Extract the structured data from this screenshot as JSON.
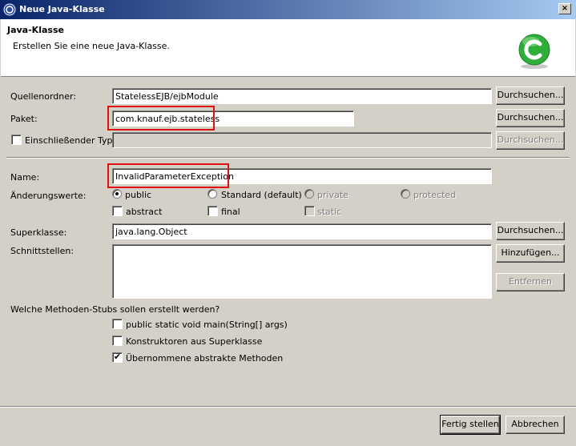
{
  "window": {
    "title": "Neue Java-Klasse",
    "close_label": "×"
  },
  "header": {
    "title": "Java-Klasse",
    "description": "Erstellen Sie eine neue Java-Klasse."
  },
  "source_folder": {
    "label": "Quellenordner:",
    "value": "StatelessEJB/ejbModule",
    "browse_label": "Durchsuchen..."
  },
  "package": {
    "label": "Paket:",
    "value": "com.knauf.ejb.stateless",
    "browse_label": "Durchsuchen..."
  },
  "enclosing_type": {
    "label": "Einschließender Typ:",
    "value": "",
    "checked": false,
    "browse_label": "Durchsuchen..."
  },
  "name": {
    "label": "Name:",
    "value": "InvalidParameterException"
  },
  "modifiers": {
    "label": "Änderungswerte:",
    "public": "public",
    "standard": "Standard (default)",
    "private": "private",
    "protected": "protected",
    "abstract": "abstract",
    "final": "final",
    "static": "static",
    "selected": "public"
  },
  "superclass": {
    "label": "Superklasse:",
    "value": "java.lang.Object",
    "browse_label": "Durchsuchen..."
  },
  "interfaces": {
    "label": "Schnittstellen:",
    "add_label": "Hinzufügen...",
    "remove_label": "Entfernen"
  },
  "stubs": {
    "question": "Welche Methoden-Stubs sollen erstellt werden?",
    "main": "public static void main(String[] args)",
    "constructors": "Konstruktoren aus Superklasse",
    "inherited": "Übernommene abstrakte Methoden",
    "check_mark": "✔"
  },
  "footer": {
    "finish_label": "Fertig stellen",
    "cancel_label": "Abbrechen"
  },
  "colors": {
    "highlight": "#e01010",
    "titlebar": "#0a246a",
    "logo": "#2fae3a"
  }
}
